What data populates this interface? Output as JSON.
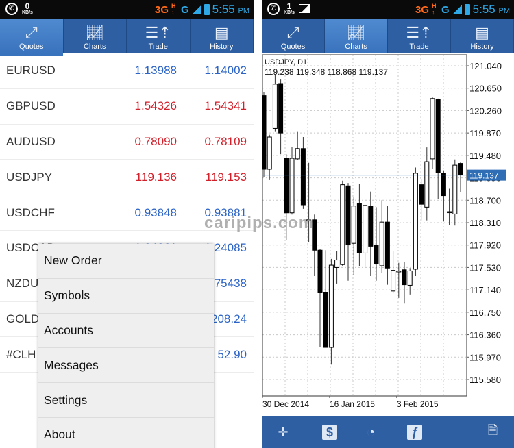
{
  "left_screen": {
    "statusbar": {
      "net_speed": "0",
      "net_unit": "KB/s",
      "network": "3G",
      "network2": "G",
      "time": "5:55",
      "ampm": "PM"
    },
    "tabs": [
      {
        "label": "Quotes",
        "icon": "quotes-arrows-icon",
        "active": true
      },
      {
        "label": "Charts",
        "icon": "chart-line-icon",
        "active": false
      },
      {
        "label": "Trade",
        "icon": "trade-list-icon",
        "active": false
      },
      {
        "label": "History",
        "icon": "history-book-icon",
        "active": false
      }
    ],
    "quotes": [
      {
        "symbol": "EURUSD",
        "bid": "1.13988",
        "ask": "1.14002",
        "direction": "up"
      },
      {
        "symbol": "GBPUSD",
        "bid": "1.54326",
        "ask": "1.54341",
        "direction": "down"
      },
      {
        "symbol": "AUDUSD",
        "bid": "0.78090",
        "ask": "0.78109",
        "direction": "down"
      },
      {
        "symbol": "USDJPY",
        "bid": "119.136",
        "ask": "119.153",
        "direction": "down"
      },
      {
        "symbol": "USDCHF",
        "bid": "0.93848",
        "ask": "0.93881",
        "direction": "up"
      },
      {
        "symbol": "USDCAD",
        "bid": "1.24061",
        "ask": "1.24085",
        "direction": "up"
      },
      {
        "symbol": "NZDUSD",
        "bid": "",
        "ask": "0.75438",
        "direction": "up"
      },
      {
        "symbol": "GOLD",
        "bid": "",
        "ask": "1208.24",
        "direction": "up"
      },
      {
        "symbol": "#CLH",
        "bid": "",
        "ask": "52.90",
        "direction": "up"
      }
    ],
    "menu": [
      "New Order",
      "Symbols",
      "Accounts",
      "Messages",
      "Settings",
      "About"
    ],
    "watermark": "caripips.com"
  },
  "right_screen": {
    "statusbar": {
      "net_speed": "1",
      "net_unit": "KB/s",
      "network": "3G",
      "network2": "G",
      "time": "5:55",
      "ampm": "PM"
    },
    "tabs": [
      {
        "label": "Quotes",
        "icon": "quotes-arrows-icon",
        "active": false
      },
      {
        "label": "Charts",
        "icon": "chart-line-icon",
        "active": true
      },
      {
        "label": "Trade",
        "icon": "trade-list-icon",
        "active": false
      },
      {
        "label": "History",
        "icon": "history-book-icon",
        "active": false
      }
    ],
    "bottom_toolbar": [
      {
        "name": "crosshair-icon",
        "glyph": "✛"
      },
      {
        "name": "dollar-icon",
        "glyph": "$"
      },
      {
        "name": "timeframe-clock-icon",
        "glyph": "◔"
      },
      {
        "name": "indicators-f-icon",
        "glyph": "ƒ"
      },
      {
        "name": "objects-settings-icon",
        "glyph": "🗎"
      }
    ]
  },
  "colors": {
    "tab_bar": "#2f5fa3",
    "tab_active": "#3a73bd",
    "price_up": "#2b63c6",
    "price_down": "#d2202a",
    "current_price_line": "#2f6db5",
    "statusbar_accent": "#2ea8e6",
    "network_accent": "#ff6a1a"
  },
  "chart_data": {
    "type": "candlestick",
    "symbol": "USDJPY",
    "timeframe": "D1",
    "title": "USDJPY, D1",
    "ohlc_label": "119.238 119.348 118.868 119.137",
    "current_price": 119.137,
    "current_price_label": "119.137",
    "ylim": [
      115.2,
      121.24
    ],
    "y_ticks": [
      "121.040",
      "120.650",
      "120.260",
      "119.870",
      "119.480",
      "119.090",
      "118.700",
      "118.310",
      "117.920",
      "117.530",
      "117.140",
      "116.750",
      "116.360",
      "115.970",
      "115.580"
    ],
    "y_tick_values": [
      121.04,
      120.65,
      120.26,
      119.87,
      119.48,
      119.09,
      118.7,
      118.31,
      117.92,
      117.53,
      117.14,
      116.75,
      116.36,
      115.97,
      115.58
    ],
    "x_labels": [
      "30 Dec 2014",
      "16 Jan 2015",
      "3 Feb 2015"
    ],
    "x_label_index": [
      0,
      12,
      24
    ],
    "grid": true,
    "candles": [
      {
        "o": 120.52,
        "h": 120.58,
        "c": 119.24,
        "l": 119.1
      },
      {
        "o": 119.24,
        "c": 119.8,
        "h": 119.84,
        "l": 119.05
      },
      {
        "o": 119.95,
        "c": 120.72,
        "h": 120.88,
        "l": 119.9
      },
      {
        "o": 120.73,
        "c": 119.87,
        "h": 120.8,
        "l": 119.5
      },
      {
        "o": 119.43,
        "c": 118.48,
        "h": 119.5,
        "l": 118.0
      },
      {
        "o": 118.48,
        "c": 119.43,
        "h": 119.63,
        "l": 118.45
      },
      {
        "o": 119.42,
        "c": 119.6,
        "h": 119.9,
        "l": 119.4
      },
      {
        "o": 119.6,
        "c": 118.62,
        "h": 119.8,
        "l": 118.55
      },
      {
        "o": 118.36,
        "c": 118.36,
        "h": 119.35,
        "l": 117.97
      },
      {
        "o": 118.36,
        "c": 117.83,
        "h": 118.45,
        "l": 117.38
      },
      {
        "o": 117.83,
        "c": 117.1,
        "h": 117.85,
        "l": 116.15
      },
      {
        "o": 117.1,
        "c": 116.14,
        "h": 117.83,
        "l": 116.14
      },
      {
        "o": 116.14,
        "c": 117.57,
        "h": 117.68,
        "l": 115.84
      },
      {
        "o": 117.53,
        "c": 117.66,
        "h": 117.82,
        "l": 117.25
      },
      {
        "o": 117.58,
        "c": 118.97,
        "h": 119.04,
        "l": 117.55
      },
      {
        "o": 118.95,
        "c": 117.93,
        "h": 119.0,
        "l": 117.3
      },
      {
        "o": 117.95,
        "c": 118.6,
        "h": 118.75,
        "l": 117.4
      },
      {
        "o": 118.64,
        "c": 117.78,
        "h": 118.98,
        "l": 117.55
      },
      {
        "o": 117.78,
        "c": 118.61,
        "h": 118.62,
        "l": 117.54
      },
      {
        "o": 118.6,
        "c": 117.9,
        "h": 118.85,
        "l": 117.38
      },
      {
        "o": 117.92,
        "c": 117.6,
        "h": 118.58,
        "l": 117.3
      },
      {
        "o": 117.56,
        "c": 118.32,
        "h": 118.7,
        "l": 117.43
      },
      {
        "o": 118.32,
        "c": 117.52,
        "h": 118.6,
        "l": 117.23
      },
      {
        "o": 117.12,
        "c": 117.48,
        "h": 117.82,
        "l": 117.08
      },
      {
        "o": 117.47,
        "c": 117.47,
        "h": 117.61,
        "l": 117.0
      },
      {
        "o": 117.49,
        "c": 117.23,
        "h": 117.62,
        "l": 116.9
      },
      {
        "o": 117.22,
        "c": 117.47,
        "h": 117.52,
        "l": 117.06
      },
      {
        "o": 117.5,
        "c": 119.17,
        "h": 119.27,
        "l": 117.38
      },
      {
        "o": 118.97,
        "c": 118.63,
        "h": 119.07,
        "l": 118.35
      },
      {
        "o": 118.58,
        "c": 119.37,
        "h": 119.62,
        "l": 118.35
      },
      {
        "o": 119.42,
        "c": 120.47,
        "h": 120.49,
        "l": 119.25
      },
      {
        "o": 120.46,
        "c": 119.18,
        "h": 120.47,
        "l": 118.72
      },
      {
        "o": 119.17,
        "c": 118.78,
        "h": 119.22,
        "l": 118.33
      },
      {
        "o": 118.5,
        "c": 118.5,
        "h": 118.9,
        "l": 118.27
      },
      {
        "o": 118.46,
        "c": 119.31,
        "h": 119.41,
        "l": 118.26
      },
      {
        "o": 119.34,
        "c": 119.14,
        "h": 119.36,
        "l": 118.84
      }
    ]
  }
}
